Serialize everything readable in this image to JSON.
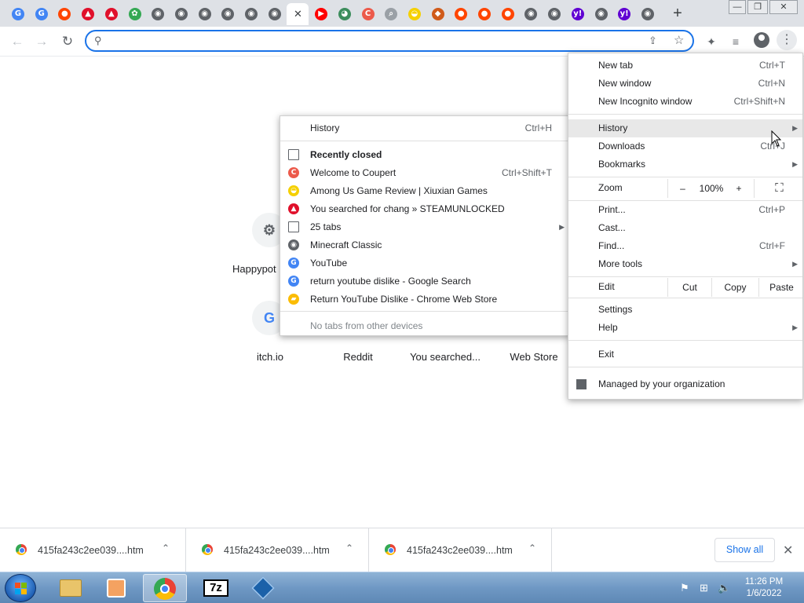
{
  "window": {
    "minimize": "—",
    "restore": "❐",
    "close": "✕"
  },
  "tabs": [
    {
      "icon": "google-icon",
      "glyph": "G",
      "color": "#4285f4"
    },
    {
      "icon": "google-icon",
      "glyph": "G",
      "color": "#4285f4"
    },
    {
      "icon": "reddit-icon",
      "glyph": "●",
      "color": "#ff4500"
    },
    {
      "icon": "steamunlocked-icon",
      "glyph": "▲",
      "color": "#e0102b"
    },
    {
      "icon": "steamunlocked-icon",
      "glyph": "▲",
      "color": "#e0102b"
    },
    {
      "icon": "green-app-icon",
      "glyph": "✿",
      "color": "#34a853"
    },
    {
      "icon": "globe-icon",
      "glyph": "◉",
      "color": "#5f6368"
    },
    {
      "icon": "globe-icon",
      "glyph": "◉",
      "color": "#5f6368"
    },
    {
      "icon": "globe-icon",
      "glyph": "◉",
      "color": "#5f6368"
    },
    {
      "icon": "globe-icon",
      "glyph": "◉",
      "color": "#5f6368"
    },
    {
      "icon": "globe-icon",
      "glyph": "◉",
      "color": "#5f6368"
    },
    {
      "icon": "globe-icon",
      "glyph": "◉",
      "color": "#5f6368"
    },
    {
      "icon": "close-icon",
      "glyph": "✕",
      "color": "#fff",
      "active": true
    },
    {
      "icon": "youtube-icon",
      "glyph": "▶",
      "color": "#ff0000"
    },
    {
      "icon": "cat-icon",
      "glyph": "◕",
      "color": "#3c8d5c"
    },
    {
      "icon": "coupert-icon",
      "glyph": "C",
      "color": "#ec5a4b"
    },
    {
      "icon": "search-icon",
      "glyph": "⌕",
      "color": "#9aa0a6"
    },
    {
      "icon": "among-us-icon",
      "glyph": "◒",
      "color": "#f5d000"
    },
    {
      "icon": "notification-icon",
      "glyph": "◆",
      "color": "#d05a1a"
    },
    {
      "icon": "reddit-icon",
      "glyph": "●",
      "color": "#ff4500"
    },
    {
      "icon": "reddit-icon",
      "glyph": "●",
      "color": "#ff4500"
    },
    {
      "icon": "reddit-icon",
      "glyph": "●",
      "color": "#ff4500"
    },
    {
      "icon": "globe-icon",
      "glyph": "◉",
      "color": "#5f6368"
    },
    {
      "icon": "globe-icon",
      "glyph": "◉",
      "color": "#5f6368"
    },
    {
      "icon": "yahoo-icon",
      "glyph": "y!",
      "color": "#6001d2"
    },
    {
      "icon": "globe-icon",
      "glyph": "◉",
      "color": "#5f6368"
    },
    {
      "icon": "yahoo-icon",
      "glyph": "y!",
      "color": "#6001d2"
    },
    {
      "icon": "globe-icon",
      "glyph": "◉",
      "color": "#5f6368"
    }
  ],
  "new_tab_glyph": "+",
  "toolbar": {
    "back": "←",
    "forward": "→",
    "reload": "↻",
    "omnibox_value": "",
    "omnibox_placeholder": "",
    "search_glyph": "⚲",
    "share_glyph": "⇪",
    "star_glyph": "☆",
    "extensions_glyph": "✦",
    "media_glyph": "≡",
    "menu_glyph": "⋮"
  },
  "shortcuts": [
    {
      "label": "Happypot",
      "glyph": "⚙",
      "color": "#5f6368"
    },
    {
      "label": "itch.io",
      "glyph": "G",
      "color": "#4285f4"
    },
    {
      "label": "Reddit",
      "glyph": "",
      "color": "#ff4500"
    },
    {
      "label": "You searched...",
      "glyph": "",
      "color": "#e0102b"
    },
    {
      "label": "Web Store",
      "glyph": "",
      "color": "#4285f4"
    }
  ],
  "history_menu": {
    "header": {
      "label": "History",
      "shortcut": "Ctrl+H"
    },
    "recently_closed": "Recently closed",
    "items": [
      {
        "label": "Welcome to Coupert",
        "shortcut": "Ctrl+Shift+T",
        "icon": "coupert-icon",
        "color": "#ec5a4b",
        "glyph": "C"
      },
      {
        "label": "Among Us Game Review | Xiuxian Games",
        "shortcut": "",
        "icon": "among-us-icon",
        "color": "#f5d000",
        "glyph": "◒"
      },
      {
        "label": "You searched for chang » STEAMUNLOCKED",
        "shortcut": "",
        "icon": "steamunlocked-icon",
        "color": "#e0102b",
        "glyph": "▲"
      },
      {
        "label": "25 tabs",
        "shortcut": "",
        "icon": "tabs-icon",
        "color": "",
        "glyph": "",
        "submenu": true
      },
      {
        "label": "Minecraft Classic",
        "shortcut": "",
        "icon": "globe-icon",
        "color": "#5f6368",
        "glyph": "◉"
      },
      {
        "label": "YouTube",
        "shortcut": "",
        "icon": "google-icon",
        "color": "#4285f4",
        "glyph": "G"
      },
      {
        "label": "return youtube dislike - Google Search",
        "shortcut": "",
        "icon": "google-icon",
        "color": "#4285f4",
        "glyph": "G"
      },
      {
        "label": "Return YouTube Dislike - Chrome Web Store",
        "shortcut": "",
        "icon": "chrome-web-store-icon",
        "color": "#fbbc05",
        "glyph": "▰"
      }
    ],
    "no_tabs": "No tabs from other devices"
  },
  "chrome_menu": {
    "new_tab": {
      "label": "New tab",
      "shortcut": "Ctrl+T"
    },
    "new_window": {
      "label": "New window",
      "shortcut": "Ctrl+N"
    },
    "incognito": {
      "label": "New Incognito window",
      "shortcut": "Ctrl+Shift+N"
    },
    "history": {
      "label": "History"
    },
    "downloads": {
      "label": "Downloads",
      "shortcut": "Ctrl+J"
    },
    "bookmarks": {
      "label": "Bookmarks"
    },
    "zoom": {
      "label": "Zoom",
      "minus": "–",
      "value": "100%",
      "plus": "+",
      "fullscreen": "⛶"
    },
    "print": {
      "label": "Print...",
      "shortcut": "Ctrl+P"
    },
    "cast": {
      "label": "Cast..."
    },
    "find": {
      "label": "Find...",
      "shortcut": "Ctrl+F"
    },
    "more_tools": {
      "label": "More tools"
    },
    "edit": {
      "label": "Edit",
      "cut": "Cut",
      "copy": "Copy",
      "paste": "Paste"
    },
    "settings": {
      "label": "Settings"
    },
    "help": {
      "label": "Help"
    },
    "exit": {
      "label": "Exit"
    },
    "managed": {
      "label": "Managed by your organization"
    },
    "arrow": "▶"
  },
  "downloads": {
    "items": [
      {
        "name": "415fa243c2ee039....htm"
      },
      {
        "name": "415fa243c2ee039....htm"
      },
      {
        "name": "415fa243c2ee039....htm"
      }
    ],
    "caret": "⌃",
    "show_all": "Show all",
    "close": "✕"
  },
  "taskbar": {
    "apps": [
      {
        "name": "explorer",
        "icon": "folder-icon",
        "color": "#e9c46a"
      },
      {
        "name": "media-player",
        "icon": "media-player-icon",
        "color": "#f4a261"
      },
      {
        "name": "chrome",
        "icon": "chrome-icon",
        "color": "#4285f4",
        "active": true
      },
      {
        "name": "7zip",
        "icon": "7zip-icon",
        "label": "7z"
      },
      {
        "name": "virtualbox",
        "icon": "virtualbox-icon",
        "color": "#1b61a9"
      }
    ],
    "tray": {
      "flag": "⚑",
      "network": "⊞",
      "volume": "🔈"
    },
    "time": "11:26 PM",
    "date": "1/6/2022"
  }
}
